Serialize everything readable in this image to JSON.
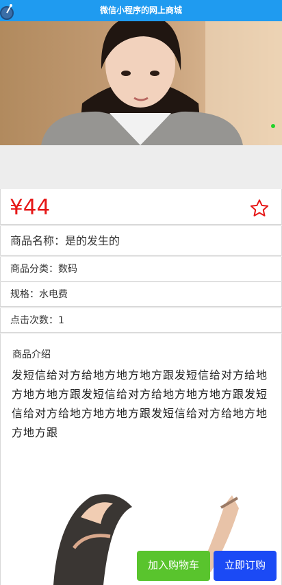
{
  "topbar": {
    "title": "微信小程序的网上商城"
  },
  "product": {
    "price": "¥44",
    "name_line": "商品名称：是的发生的",
    "category_line": "商品分类：数码",
    "spec_line": "规格：水电费",
    "clicks_line": "点击次数：1"
  },
  "intro": {
    "title": "商品介绍",
    "text": "发短信给对方给地方地方地方跟发短信给对方给地方地方地方跟发短信给对方给地方地方地方跟发短信给对方给地方地方地方跟发短信给对方给地方地方地方跟"
  },
  "actions": {
    "add_to_cart": "加入购物车",
    "buy_now": "立即订购"
  },
  "colors": {
    "price": "#e61717",
    "add_to_cart": "#59c42d",
    "buy_now": "#1b4af5",
    "topbar": "#1f9bf0"
  }
}
